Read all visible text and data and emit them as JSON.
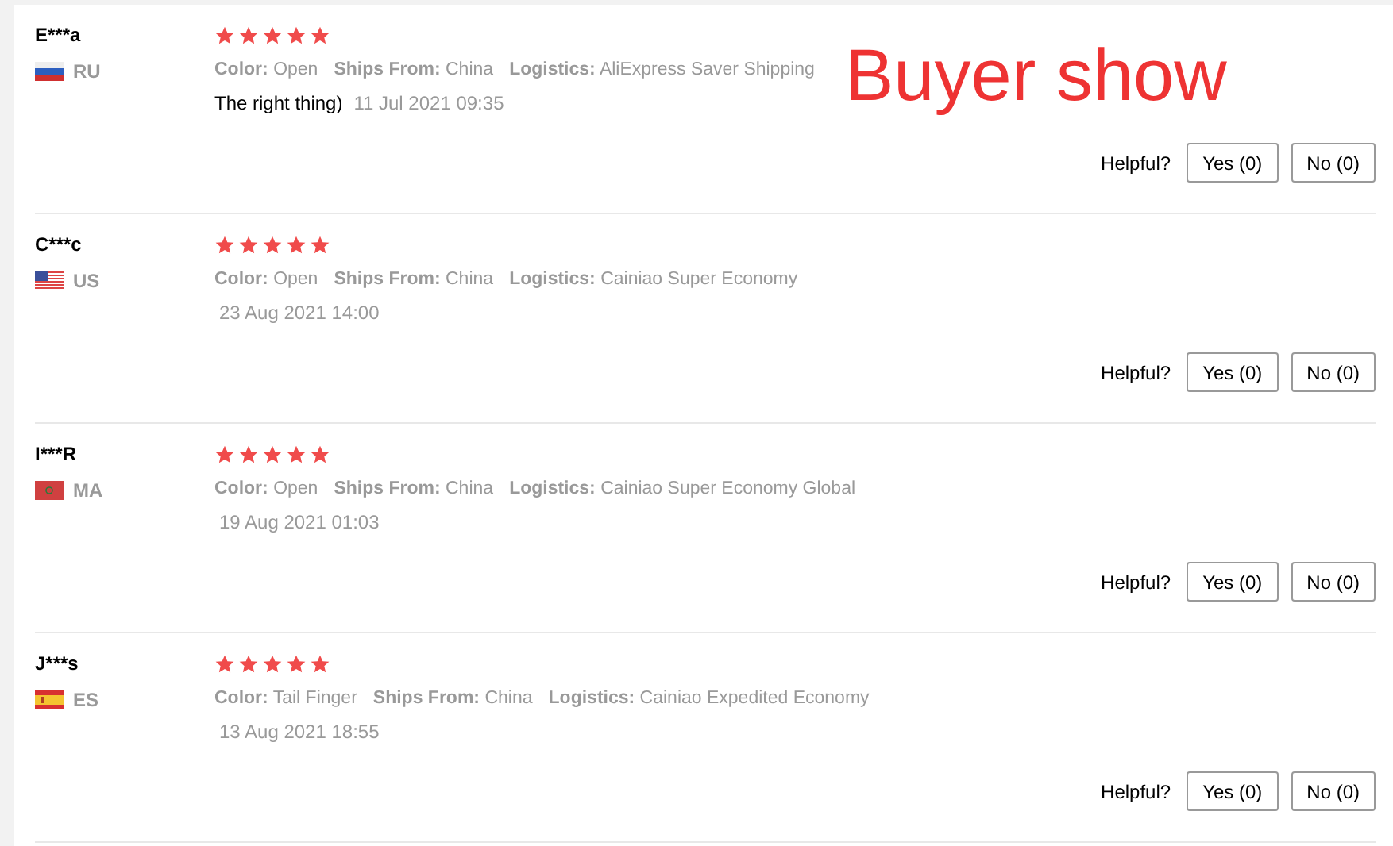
{
  "overlay_caption": "Buyer show",
  "reviews": [
    {
      "user": "E***a",
      "country": "RU",
      "kind": "ru",
      "stars": 5,
      "attributes": [
        {
          "label": "Color:",
          "value": "Open"
        },
        {
          "label": "Ships From:",
          "value": "China"
        },
        {
          "label": "Logistics:",
          "value": "AliExpress Saver Shipping"
        }
      ],
      "comment": "The right thing)",
      "date": "11 Jul 2021 09:35",
      "helpful_label": "Helpful?",
      "yes": "Yes (0)",
      "no": "No (0)"
    },
    {
      "user": "C***c",
      "country": "US",
      "kind": "us",
      "stars": 5,
      "attributes": [
        {
          "label": "Color:",
          "value": "Open"
        },
        {
          "label": "Ships From:",
          "value": "China"
        },
        {
          "label": "Logistics:",
          "value": "Cainiao Super Economy"
        }
      ],
      "date": "23 Aug 2021 14:00",
      "helpful_label": "Helpful?",
      "yes": "Yes (0)",
      "no": "No (0)"
    },
    {
      "user": "I***R",
      "country": "MA",
      "kind": "ma",
      "stars": 5,
      "attributes": [
        {
          "label": "Color:",
          "value": "Open"
        },
        {
          "label": "Ships From:",
          "value": "China"
        },
        {
          "label": "Logistics:",
          "value": "Cainiao Super Economy Global"
        }
      ],
      "date": "19 Aug 2021 01:03",
      "helpful_label": "Helpful?",
      "yes": "Yes (0)",
      "no": "No (0)"
    },
    {
      "user": "J***s",
      "country": "ES",
      "kind": "es",
      "stars": 5,
      "attributes": [
        {
          "label": "Color:",
          "value": "Tail Finger"
        },
        {
          "label": "Ships From:",
          "value": "China"
        },
        {
          "label": "Logistics:",
          "value": "Cainiao Expedited Economy"
        }
      ],
      "date": "13 Aug 2021 18:55",
      "helpful_label": "Helpful?",
      "yes": "Yes (0)",
      "no": "No (0)"
    }
  ]
}
